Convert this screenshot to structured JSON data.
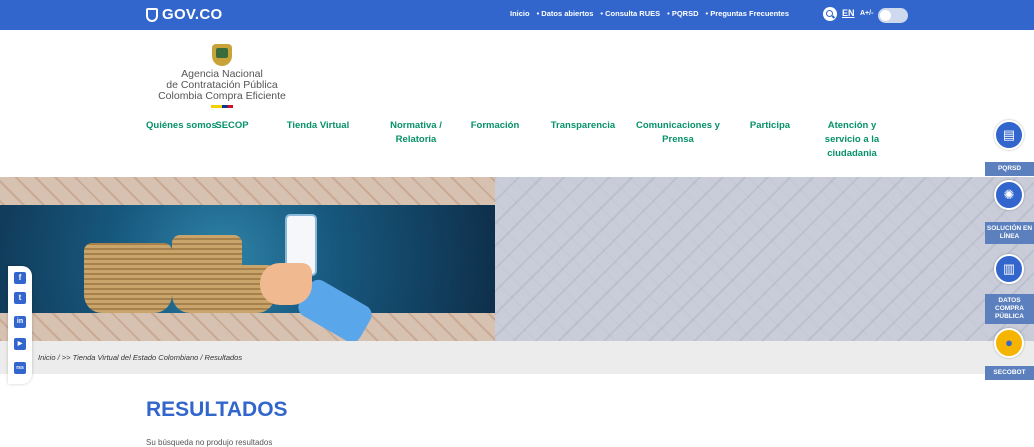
{
  "topbar": {
    "logo": "GOV.CO",
    "links": [
      "Inicio",
      "• Datos abiertos",
      "• Consulta RUES",
      "• PQRSD",
      "• Preguntas Frecuentes"
    ],
    "lang": "EN",
    "contrast": "A+/-"
  },
  "agency": {
    "line1": "Agencia Nacional",
    "line2": "de Contratación Pública",
    "line3": "Colombia Compra Eficiente"
  },
  "nav": [
    "Quiénes somos",
    "SECOP",
    "Tienda Virtual",
    "Normativa / Relatoria",
    "Formación",
    "Transparencia",
    "Comunicaciones y Prensa",
    "Participa",
    "Atención y servicio a la ciudadania"
  ],
  "sidebar": {
    "pqrsd": "PQRSD",
    "solucion": "SOLUCIÓN EN LÍNEA",
    "datos": "DATOS COMPRA PÚBLICA",
    "secobot": "SECOBOT"
  },
  "social": [
    "f",
    "t",
    "in",
    "▶",
    "rss"
  ],
  "breadcrumb": "Inicio / >> Tienda Virtual del Estado Colombiano / Resultados",
  "results": {
    "title": "RESULTADOS",
    "message": "Su búsqueda no produjo resultados"
  },
  "colors": {
    "topbar": "#3366cc",
    "nav_text": "#069169",
    "title": "#3366cc"
  },
  "icons": [
    "shield-icon",
    "search-icon",
    "toggle-icon",
    "coat-of-arms-icon",
    "facebook-icon",
    "twitter-icon",
    "linkedin-icon",
    "youtube-icon",
    "rss-icon",
    "document-icon",
    "lightbulb-icon",
    "chart-icon",
    "bot-icon"
  ]
}
